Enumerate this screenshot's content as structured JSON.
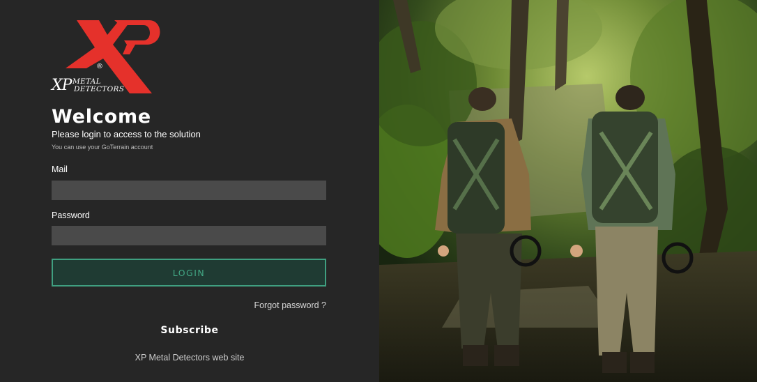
{
  "brand": {
    "logo_mark": "XP",
    "logo_xp": "XP",
    "logo_line1": "METAL",
    "logo_line2": "DETECTORS",
    "registered": "®",
    "logo_color": "#e5312b"
  },
  "login": {
    "title": "Welcome",
    "subtitle": "Please login to access to the solution",
    "hint": "You can use your GoTerrain account",
    "mail_label": "Mail",
    "mail_value": "",
    "password_label": "Password",
    "password_value": "",
    "submit_label": "LOGIN",
    "forgot_label": "Forgot password ?",
    "accent_color": "#3f9f80"
  },
  "footer": {
    "subscribe_label": "Subscribe",
    "website_label": "XP Metal Detectors web site"
  },
  "hero_image": {
    "icon": "forest-hikers-photo"
  }
}
